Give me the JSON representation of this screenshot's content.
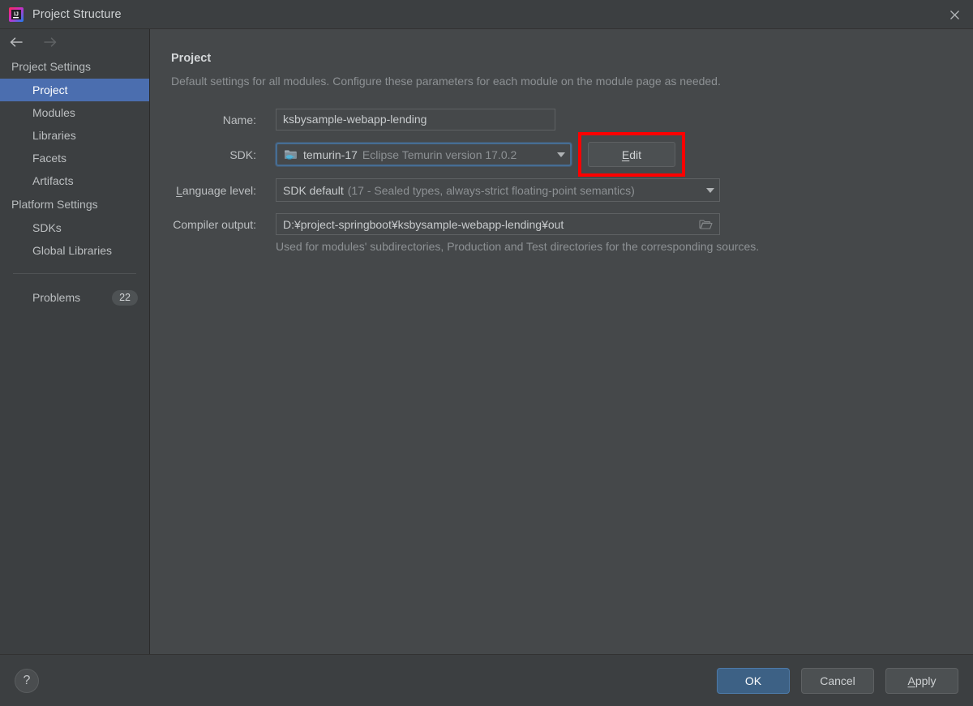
{
  "window": {
    "title": "Project Structure",
    "app_icon": "intellij-idea-icon",
    "close_icon": "close-icon"
  },
  "sidebar": {
    "back_icon": "back-arrow-icon",
    "forward_icon": "forward-arrow-icon",
    "groups": [
      {
        "header": "Project Settings",
        "items": [
          {
            "label": "Project",
            "selected": true
          },
          {
            "label": "Modules",
            "selected": false
          },
          {
            "label": "Libraries",
            "selected": false
          },
          {
            "label": "Facets",
            "selected": false
          },
          {
            "label": "Artifacts",
            "selected": false
          }
        ]
      },
      {
        "header": "Platform Settings",
        "items": [
          {
            "label": "SDKs",
            "selected": false
          },
          {
            "label": "Global Libraries",
            "selected": false
          }
        ]
      }
    ],
    "problems": {
      "label": "Problems",
      "count": "22"
    }
  },
  "main": {
    "title": "Project",
    "description": "Default settings for all modules. Configure these parameters for each module on the module page as needed.",
    "name": {
      "label": "Name:",
      "value": "ksbysample-webapp-lending"
    },
    "sdk": {
      "label": "SDK:",
      "icon": "java-sdk-folder-icon",
      "value_name": "temurin-17",
      "value_version": "Eclipse Temurin version 17.0.2",
      "dropdown_icon": "chevron-down-icon",
      "edit_button": "Edit",
      "edit_button_mnemonic": "E",
      "edit_button_rest": "dit"
    },
    "language_level": {
      "label": "Language level:",
      "label_mnemonic": "L",
      "label_rest": "anguage level:",
      "value_main": "SDK default",
      "value_detail": "(17 - Sealed types, always-strict floating-point semantics)",
      "dropdown_icon": "chevron-down-icon"
    },
    "compiler_output": {
      "label": "Compiler output:",
      "value": "D:¥project-springboot¥ksbysample-webapp-lending¥out",
      "browse_icon": "folder-open-icon",
      "hint": "Used for modules' subdirectories, Production and Test directories for the corresponding sources."
    }
  },
  "footer": {
    "help_icon": "help-question-icon",
    "ok": "OK",
    "cancel": "Cancel",
    "apply_mnemonic": "A",
    "apply_rest": "pply",
    "apply": "Apply"
  },
  "annotation": {
    "highlight_color": "#fe0000",
    "highlight_target": "edit-button"
  },
  "colors": {
    "accent_selection": "#4b6eaf",
    "primary_button": "#3d6185",
    "sidebar_bg": "#3c3f41",
    "main_bg": "#45484a",
    "focus_ring": "#466d94"
  }
}
